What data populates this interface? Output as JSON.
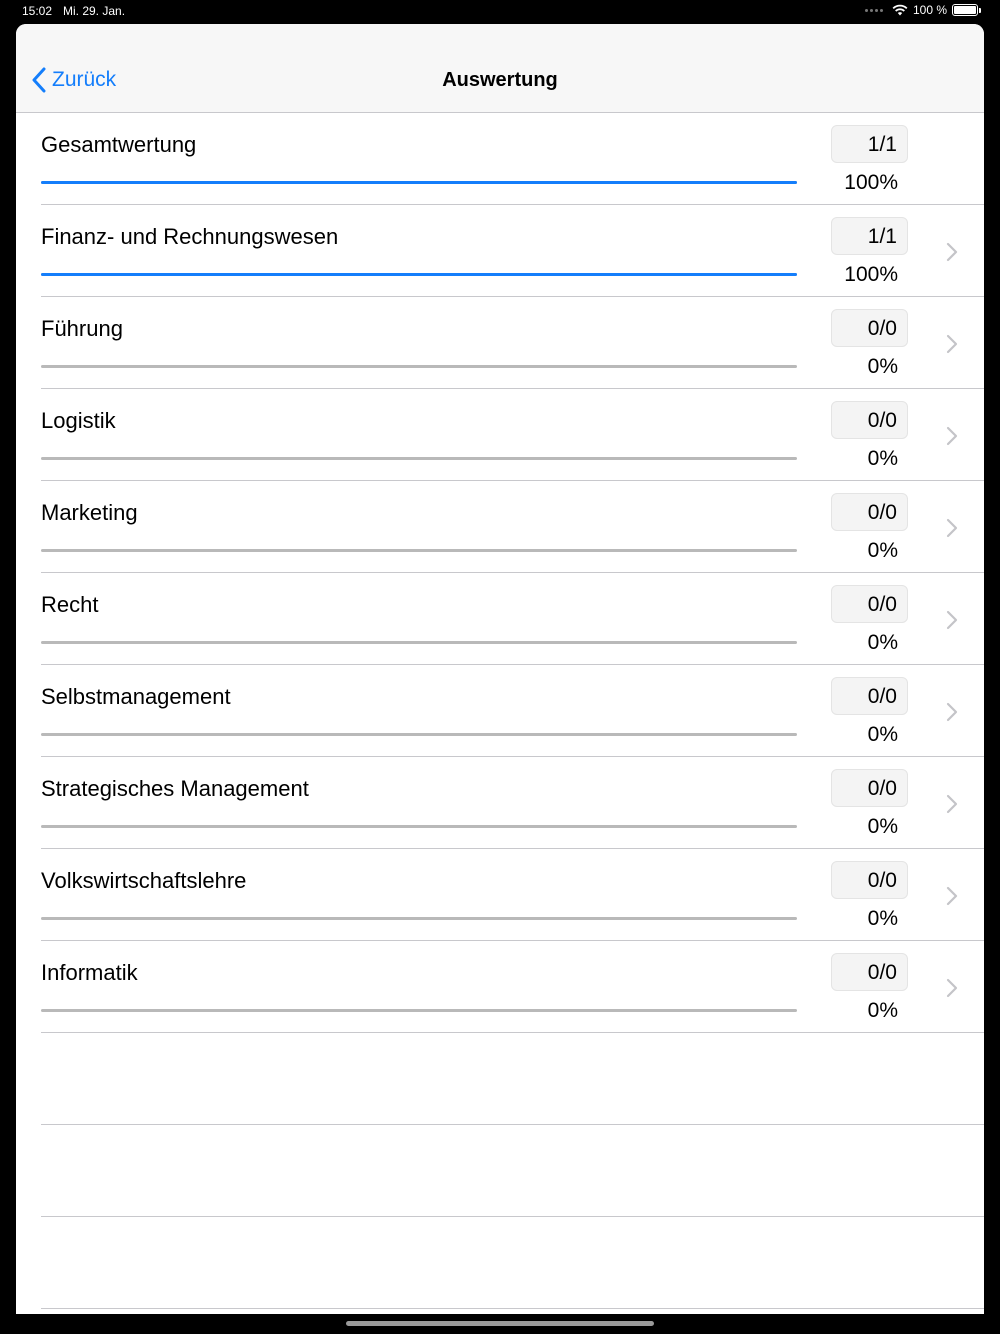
{
  "status_bar": {
    "time": "15:02",
    "date": "Mi. 29. Jan.",
    "battery": "100 %"
  },
  "navbar": {
    "back_label": "Zurück",
    "title": "Auswertung"
  },
  "colors": {
    "accent": "#147efb",
    "track": "#b9b9b9"
  },
  "rows": [
    {
      "label": "Gesamtwertung",
      "count": "1/1",
      "percent": "100%",
      "progress": 1.0,
      "disclosure": false
    },
    {
      "label": "Finanz- und Rechnungswesen",
      "count": "1/1",
      "percent": "100%",
      "progress": 1.0,
      "disclosure": true
    },
    {
      "label": "Führung",
      "count": "0/0",
      "percent": "0%",
      "progress": 0.0,
      "disclosure": true
    },
    {
      "label": "Logistik",
      "count": "0/0",
      "percent": "0%",
      "progress": 0.0,
      "disclosure": true
    },
    {
      "label": "Marketing",
      "count": "0/0",
      "percent": "0%",
      "progress": 0.0,
      "disclosure": true
    },
    {
      "label": "Recht",
      "count": "0/0",
      "percent": "0%",
      "progress": 0.0,
      "disclosure": true
    },
    {
      "label": "Selbstmanagement",
      "count": "0/0",
      "percent": "0%",
      "progress": 0.0,
      "disclosure": true
    },
    {
      "label": "Strategisches Management",
      "count": "0/0",
      "percent": "0%",
      "progress": 0.0,
      "disclosure": true
    },
    {
      "label": "Volkswirtschaftslehre",
      "count": "0/0",
      "percent": "0%",
      "progress": 0.0,
      "disclosure": true
    },
    {
      "label": "Informatik",
      "count": "0/0",
      "percent": "0%",
      "progress": 0.0,
      "disclosure": true
    }
  ]
}
